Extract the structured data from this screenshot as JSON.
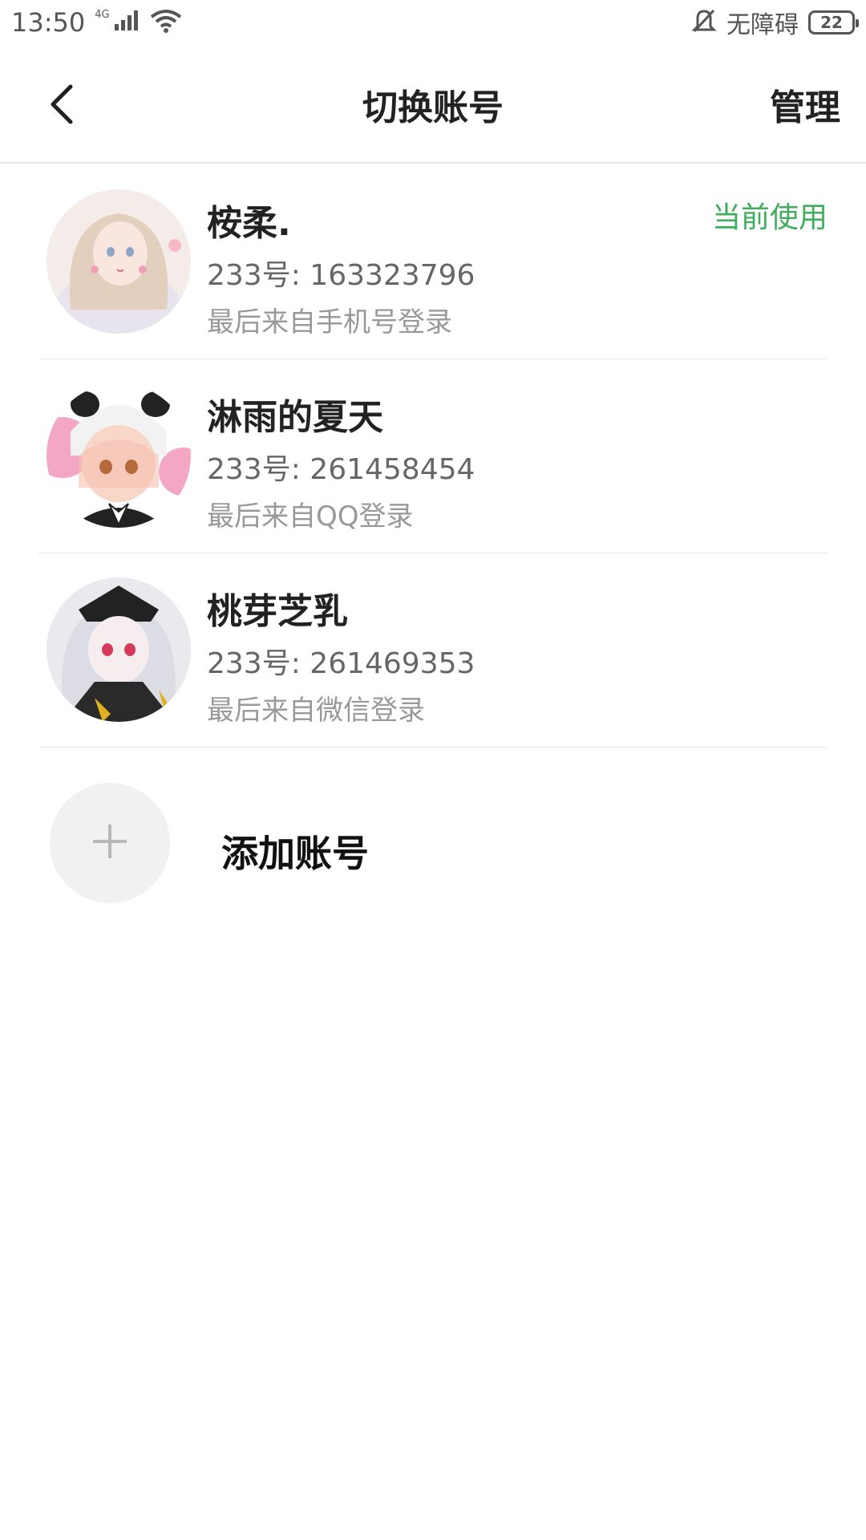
{
  "status_bar": {
    "time": "13:50",
    "network": "4G",
    "accessibility_text": "无障碍",
    "battery": "22",
    "icons": [
      "signal-icon",
      "wifi-icon",
      "bell-off-icon",
      "battery-icon"
    ]
  },
  "header": {
    "title": "切换账号",
    "manage_label": "管理",
    "back_icon": "chevron-left-icon"
  },
  "accounts": [
    {
      "name": "桉柔.",
      "id_text": "233号: 163323796",
      "login_text": "最后来自手机号登录",
      "current_label": "当前使用"
    },
    {
      "name": "淋雨的夏天",
      "id_text": "233号: 261458454",
      "login_text": "最后来自QQ登录"
    },
    {
      "name": "桃芽芝乳",
      "id_text": "233号: 261469353",
      "login_text": "最后来自微信登录"
    }
  ],
  "add_account": {
    "label": "添加账号",
    "icon": "plus-icon"
  },
  "colors": {
    "accent_green": "#3fae5b",
    "divider": "#e8e8e8",
    "add_circle_bg": "#f1f1f1"
  }
}
